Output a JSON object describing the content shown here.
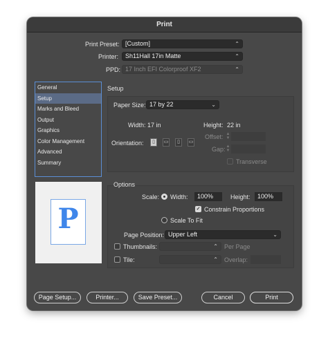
{
  "window": {
    "title": "Print"
  },
  "print_preset": {
    "label": "Print Preset:",
    "value": "[Custom]"
  },
  "printer": {
    "label": "Printer:",
    "value": "Sh11Hall 17in Matte"
  },
  "ppd": {
    "label": "PPD:",
    "value": "17 Inch EFI Colorproof XF2"
  },
  "sidebar": {
    "items": [
      {
        "label": "General",
        "active": false
      },
      {
        "label": "Setup",
        "active": true
      },
      {
        "label": "Marks and Bleed",
        "active": false
      },
      {
        "label": "Output",
        "active": false
      },
      {
        "label": "Graphics",
        "active": false
      },
      {
        "label": "Color Management",
        "active": false
      },
      {
        "label": "Advanced",
        "active": false
      },
      {
        "label": "Summary",
        "active": false
      }
    ]
  },
  "setup": {
    "heading": "Setup",
    "paper_size_label": "Paper Size:",
    "paper_size_value": "17 by 22",
    "width_label": "Width:",
    "width_value": "17 in",
    "height_label": "Height:",
    "height_value": "22 in",
    "orientation_label": "Orientation:",
    "offset_label": "Offset:",
    "gap_label": "Gap:",
    "transverse_label": "Transverse"
  },
  "preview": {
    "glyph": "P"
  },
  "options": {
    "heading": "Options",
    "scale_label": "Scale:",
    "scale_width_label": "Width:",
    "scale_width_value": "100%",
    "scale_height_label": "Height:",
    "scale_height_value": "100%",
    "constrain_label": "Constrain Proportions",
    "scale_to_fit_label": "Scale To Fit",
    "page_position_label": "Page Position:",
    "page_position_value": "Upper Left",
    "thumbnails_label": "Thumbnails:",
    "per_page_label": "Per Page",
    "tile_label": "Tile:",
    "overlap_label": "Overlap:"
  },
  "buttons": {
    "page_setup": "Page Setup...",
    "printer": "Printer...",
    "save_preset": "Save Preset...",
    "cancel": "Cancel",
    "print": "Print"
  },
  "icons": {
    "chevron": "chevron-updown-icon",
    "orientation": [
      "portrait-icon",
      "landscape-icon",
      "reverse-portrait-icon",
      "reverse-landscape-icon"
    ]
  },
  "colors": {
    "window_bg": "#484848",
    "selection": "#5b6b86",
    "focus": "#5b8fd6",
    "preview_glyph": "#3f86ea"
  }
}
